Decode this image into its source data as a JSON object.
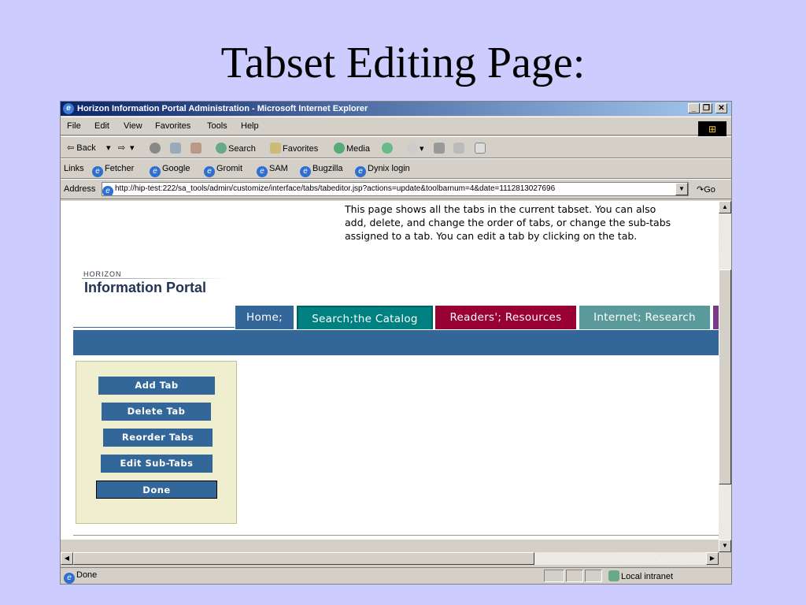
{
  "slide": {
    "title": "Tabset Editing Page:"
  },
  "window": {
    "title": "Horizon Information Portal Administration - Microsoft Internet Explorer",
    "min": "_",
    "max": "❐",
    "close": "✕"
  },
  "menu": [
    "File",
    "Edit",
    "View",
    "Favorites",
    "Tools",
    "Help"
  ],
  "toolbar": {
    "back": "⇦ Back",
    "back_dd": "▾",
    "forward": "⇨",
    "forward_dd": "▾",
    "search": "Search",
    "favorites": "Favorites",
    "media": "Media"
  },
  "links": {
    "label": "Links",
    "items": [
      "Fetcher",
      "Google",
      "Gromit",
      "SAM",
      "Bugzilla",
      "Dynix login"
    ]
  },
  "address": {
    "label": "Address",
    "url": "http://hip-test:222/sa_tools/admin/customize/interface/tabs/tabeditor.jsp?actions=update&toolbarnum=4&date=1112813027696",
    "go": "Go"
  },
  "page": {
    "description": "This page shows all the tabs in the current tabset. You can also add, delete, and change the order of tabs, or change the sub-tabs assigned to a tab. You can edit a tab by clicking on the tab.",
    "logo_small": "HORIZON",
    "logo_big": "Information Portal",
    "tabs": [
      {
        "label": "Home;",
        "color": "#336699"
      },
      {
        "label": "Search;the Catalog",
        "color": "#008080"
      },
      {
        "label": "Readers'; Resources",
        "color": "#990033"
      },
      {
        "label": "Internet; Research",
        "color": "#5a9a9a"
      }
    ],
    "buttons": [
      "Add Tab",
      "Delete Tab",
      "Reorder Tabs",
      "Edit Sub-Tabs",
      "Done"
    ]
  },
  "status": {
    "text": "Done",
    "zone": "Local intranet"
  },
  "colors": {
    "accent": "#336699",
    "panel": "#efefcf",
    "slide_bg": "#ccccff"
  }
}
